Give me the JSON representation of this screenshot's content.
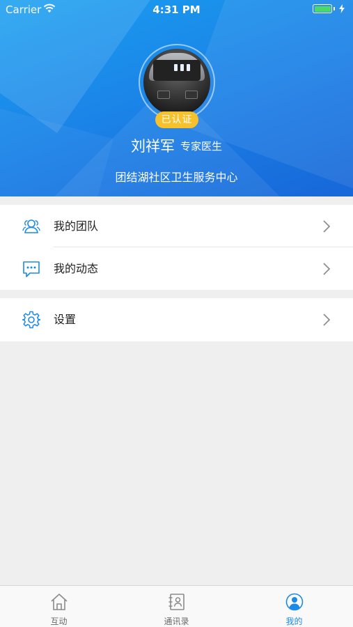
{
  "status_bar": {
    "carrier": "Carrier",
    "time": "4:31 PM"
  },
  "profile": {
    "badge": "已认证",
    "name": "刘祥军",
    "role": "专家医生",
    "organization": "团结湖社区卫生服务中心"
  },
  "menu": {
    "group1": [
      {
        "label": "我的团队",
        "icon": "team-icon"
      },
      {
        "label": "我的动态",
        "icon": "message-icon"
      }
    ],
    "group2": [
      {
        "label": "设置",
        "icon": "gear-icon"
      }
    ]
  },
  "tabs": [
    {
      "label": "互动",
      "icon": "home-icon",
      "active": false
    },
    {
      "label": "通讯录",
      "icon": "contacts-icon",
      "active": false
    },
    {
      "label": "我的",
      "icon": "profile-icon",
      "active": true
    }
  ],
  "colors": {
    "accent": "#1a8ae8",
    "badge": "#f7c12b",
    "header": "#1b7fe6"
  }
}
